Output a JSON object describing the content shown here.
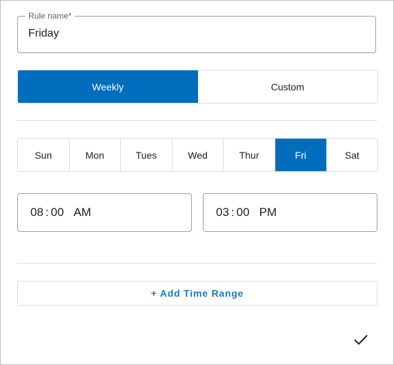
{
  "rule_name": {
    "label": "Rule name*",
    "value": "Friday"
  },
  "schedule_type": {
    "options": [
      "Weekly",
      "Custom"
    ],
    "selected": "Weekly"
  },
  "days": {
    "items": [
      "Sun",
      "Mon",
      "Tues",
      "Wed",
      "Thur",
      "Fri",
      "Sat"
    ],
    "selected": "Fri"
  },
  "start_time": {
    "hour": "08",
    "separator": ":",
    "minute": "00",
    "period": "AM"
  },
  "end_time": {
    "hour": "03",
    "separator": ":",
    "minute": "00",
    "period": "PM"
  },
  "add_time_range": {
    "label": "+ Add Time Range"
  },
  "confirm": {
    "icon": "checkmark-icon"
  },
  "colors": {
    "accent": "#006ebd",
    "link": "#1f78c1",
    "border": "#dcdcdc"
  }
}
